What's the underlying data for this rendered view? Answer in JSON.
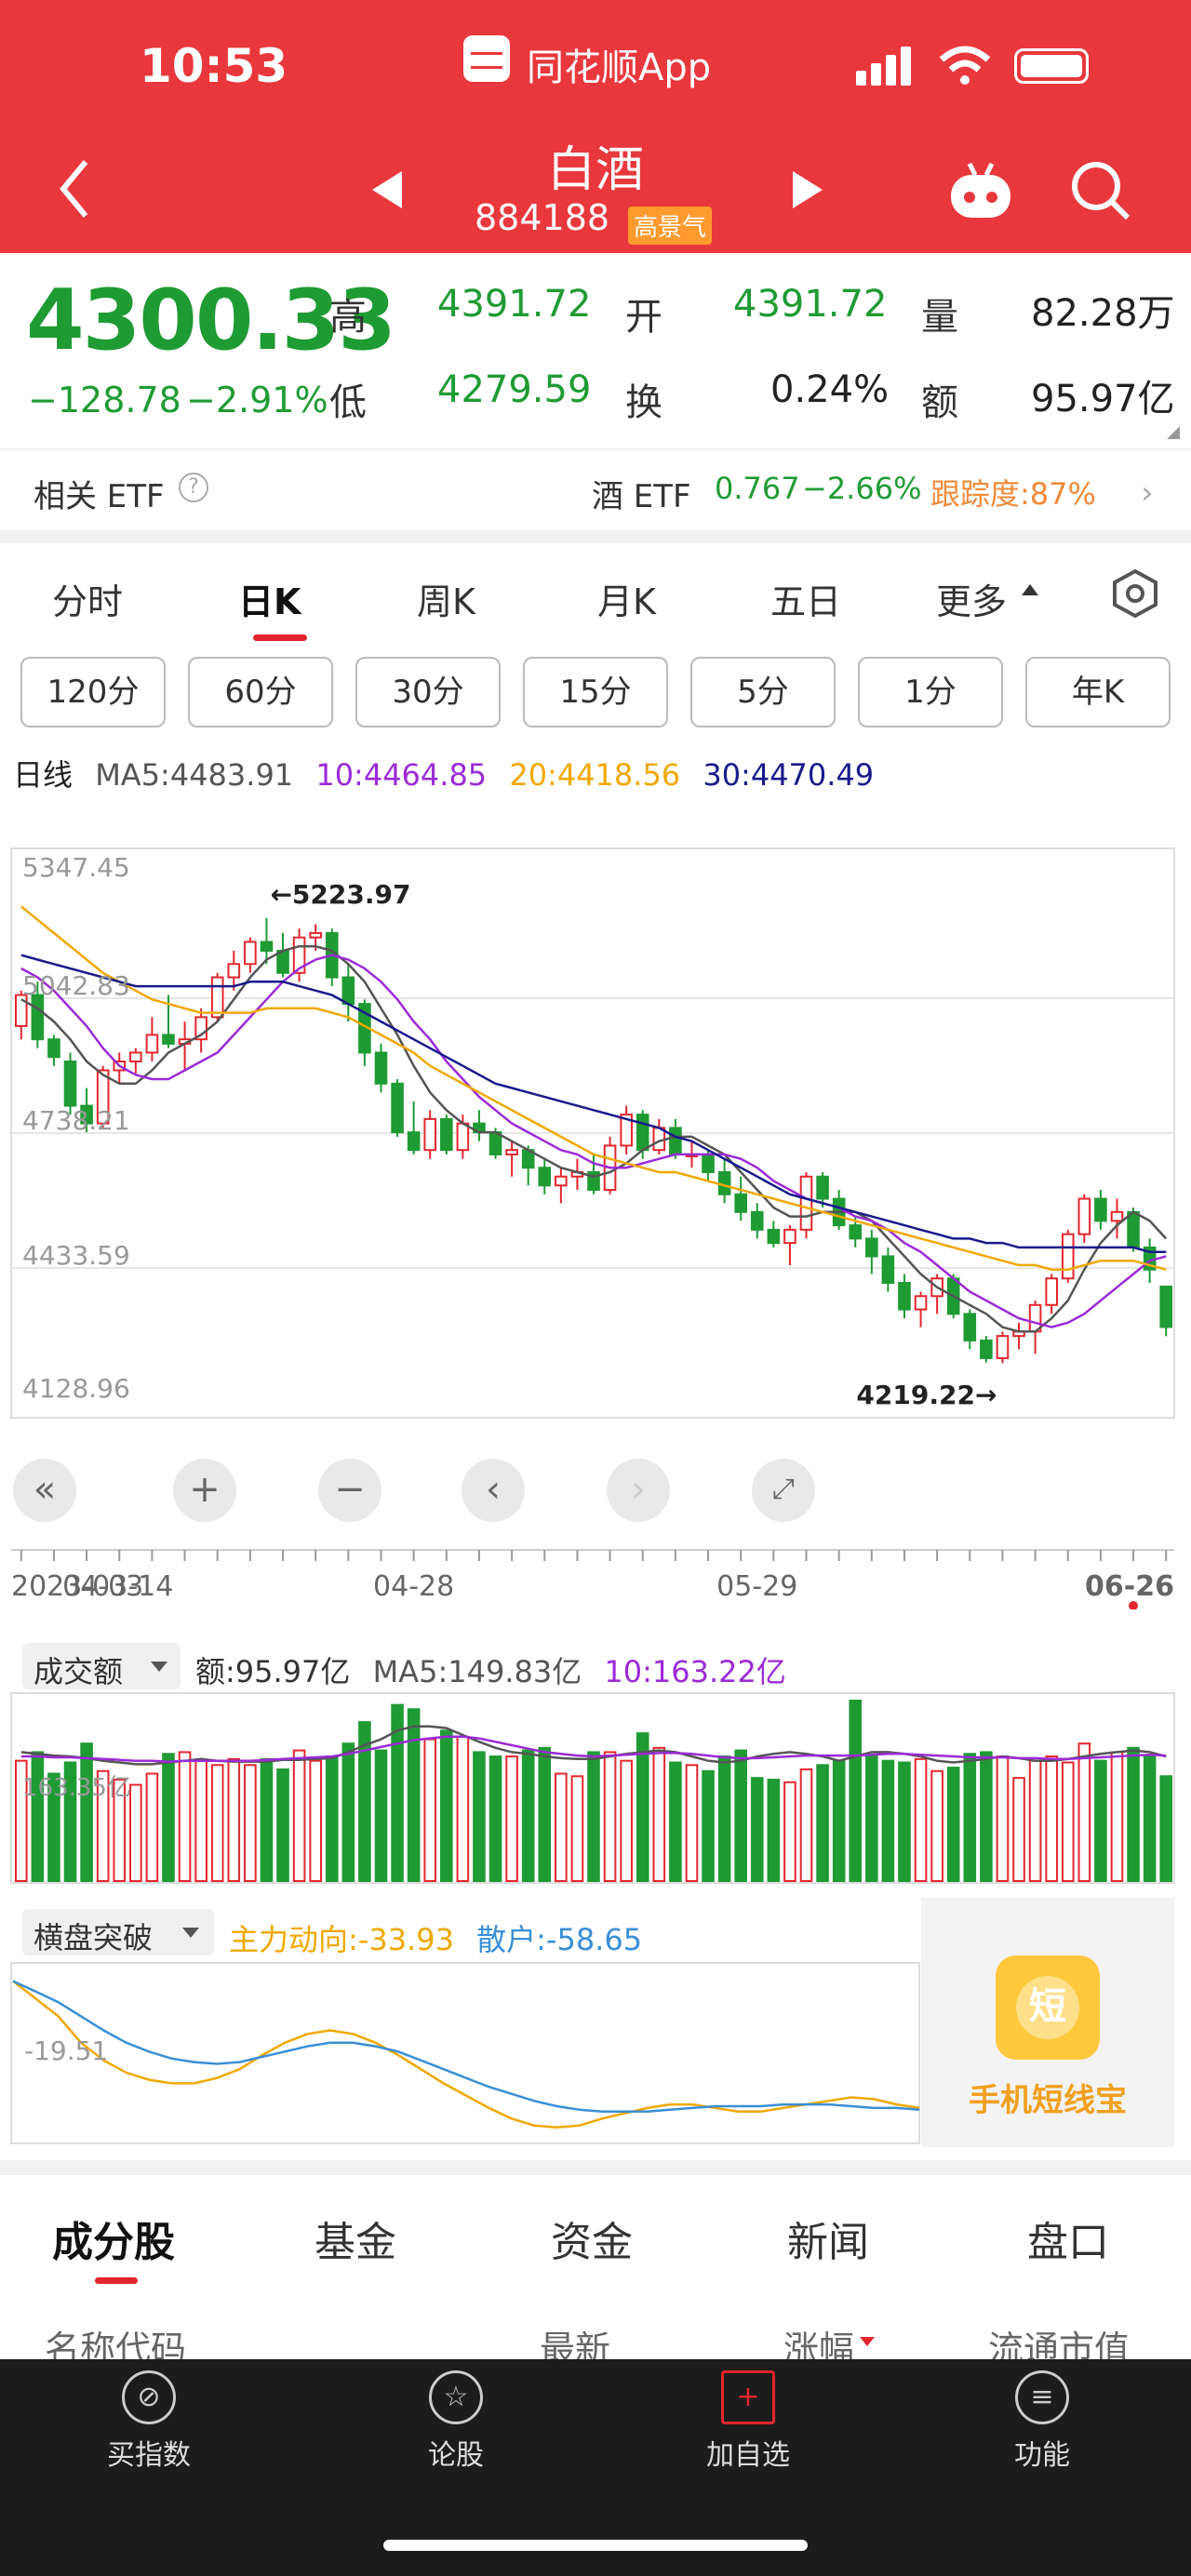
{
  "status_bar": {
    "time": "10:53",
    "app_label": "同花顺App"
  },
  "header": {
    "title": "白酒",
    "code": "884188",
    "tag": "高景气"
  },
  "quote": {
    "price": "4300.33",
    "change": "−128.78",
    "change_pct": "−2.91%",
    "high_label": "高",
    "high": "4391.72",
    "low_label": "低",
    "low": "4279.59",
    "open_label": "开",
    "open": "4391.72",
    "turnover_label": "换",
    "turnover": "0.24%",
    "volume_label": "量",
    "volume": "82.28万",
    "amount_label": "额",
    "amount": "95.97亿"
  },
  "etf": {
    "label": "相关 ETF",
    "name": "酒 ETF",
    "price": "0.767",
    "pct": "−2.66%",
    "tracking": "跟踪度:87%"
  },
  "chart_tabs": [
    "分时",
    "日K",
    "周K",
    "月K",
    "五日",
    "更多"
  ],
  "periods": [
    "120分",
    "60分",
    "30分",
    "15分",
    "5分",
    "1分",
    "年K"
  ],
  "ma_legend": {
    "prefix": "日线",
    "ma5": "MA5:4483.91",
    "ma10": "10:4464.85",
    "ma20": "20:4418.56",
    "ma30": "30:4470.49"
  },
  "colors": {
    "up": "#e3262e",
    "down": "#1f9b34",
    "ma5": "#555555",
    "ma10": "#9b2bd6",
    "ma20": "#f0a800",
    "ma30": "#1a1a8c",
    "header": "#e8383d"
  },
  "chart_data": [
    {
      "type": "candlestick",
      "y_ticks": [
        "5347.45",
        "5042.83",
        "4738.21",
        "4433.59",
        "4128.96"
      ],
      "ylim": [
        4128.96,
        5347.45
      ],
      "x_ticks": [
        "2023-03-14",
        "04-03",
        "04-28",
        "05-29",
        "06-26"
      ],
      "annotations": [
        "←5223.97",
        "4219.22→"
      ],
      "candles": [
        [
          4980,
          5060,
          4950,
          5050
        ],
        [
          5050,
          5080,
          4930,
          4950
        ],
        [
          4950,
          4960,
          4890,
          4910
        ],
        [
          4900,
          4920,
          4780,
          4800
        ],
        [
          4800,
          4840,
          4740,
          4760
        ],
        [
          4760,
          4890,
          4750,
          4880
        ],
        [
          4880,
          4920,
          4850,
          4900
        ],
        [
          4900,
          4930,
          4870,
          4920
        ],
        [
          4920,
          5000,
          4900,
          4960
        ],
        [
          4960,
          5050,
          4930,
          4940
        ],
        [
          4940,
          4990,
          4880,
          4950
        ],
        [
          4950,
          5020,
          4920,
          5000
        ],
        [
          5000,
          5100,
          4990,
          5090
        ],
        [
          5090,
          5150,
          5060,
          5120
        ],
        [
          5120,
          5180,
          5100,
          5170
        ],
        [
          5170,
          5224,
          5120,
          5150
        ],
        [
          5150,
          5190,
          5090,
          5100
        ],
        [
          5100,
          5200,
          5080,
          5180
        ],
        [
          5180,
          5210,
          5150,
          5190
        ],
        [
          5190,
          5200,
          5070,
          5090
        ],
        [
          5090,
          5120,
          4990,
          5030
        ],
        [
          5030,
          5040,
          4890,
          4920
        ],
        [
          4920,
          4940,
          4830,
          4850
        ],
        [
          4850,
          4860,
          4730,
          4740
        ],
        [
          4740,
          4810,
          4690,
          4700
        ],
        [
          4700,
          4790,
          4680,
          4770
        ],
        [
          4770,
          4780,
          4690,
          4700
        ],
        [
          4700,
          4780,
          4680,
          4760
        ],
        [
          4760,
          4790,
          4720,
          4740
        ],
        [
          4740,
          4750,
          4680,
          4690
        ],
        [
          4690,
          4720,
          4640,
          4700
        ],
        [
          4700,
          4710,
          4620,
          4660
        ],
        [
          4660,
          4680,
          4600,
          4620
        ],
        [
          4620,
          4660,
          4580,
          4640
        ],
        [
          4640,
          4680,
          4610,
          4650
        ],
        [
          4650,
          4690,
          4600,
          4610
        ],
        [
          4610,
          4730,
          4600,
          4710
        ],
        [
          4710,
          4800,
          4690,
          4780
        ],
        [
          4780,
          4790,
          4680,
          4700
        ],
        [
          4700,
          4770,
          4690,
          4750
        ],
        [
          4750,
          4770,
          4680,
          4690
        ],
        [
          4690,
          4720,
          4660,
          4690
        ],
        [
          4690,
          4700,
          4630,
          4650
        ],
        [
          4650,
          4680,
          4580,
          4600
        ],
        [
          4600,
          4640,
          4540,
          4560
        ],
        [
          4560,
          4580,
          4500,
          4520
        ],
        [
          4520,
          4540,
          4480,
          4490
        ],
        [
          4490,
          4530,
          4440,
          4520
        ],
        [
          4520,
          4650,
          4500,
          4640
        ],
        [
          4640,
          4650,
          4570,
          4590
        ],
        [
          4590,
          4610,
          4520,
          4530
        ],
        [
          4530,
          4550,
          4480,
          4500
        ],
        [
          4500,
          4520,
          4420,
          4460
        ],
        [
          4460,
          4480,
          4380,
          4400
        ],
        [
          4400,
          4420,
          4320,
          4340
        ],
        [
          4340,
          4380,
          4300,
          4370
        ],
        [
          4370,
          4420,
          4330,
          4410
        ],
        [
          4410,
          4420,
          4320,
          4330
        ],
        [
          4330,
          4340,
          4250,
          4270
        ],
        [
          4270,
          4280,
          4220,
          4230
        ],
        [
          4230,
          4290,
          4219,
          4280
        ],
        [
          4280,
          4310,
          4250,
          4290
        ],
        [
          4290,
          4360,
          4240,
          4350
        ],
        [
          4350,
          4420,
          4330,
          4410
        ],
        [
          4410,
          4520,
          4400,
          4510
        ],
        [
          4510,
          4600,
          4490,
          4590
        ],
        [
          4590,
          4610,
          4520,
          4540
        ],
        [
          4540,
          4590,
          4500,
          4560
        ],
        [
          4560,
          4570,
          4470,
          4480
        ],
        [
          4480,
          4500,
          4400,
          4430
        ],
        [
          4391.72,
          4391.72,
          4279.59,
          4300.33
        ]
      ],
      "ma_series": [
        {
          "name": "MA5",
          "values": [
            5040,
            5020,
            4990,
            4950,
            4900,
            4870,
            4850,
            4850,
            4880,
            4920,
            4940,
            4960,
            4990,
            5040,
            5090,
            5130,
            5150,
            5160,
            5160,
            5150,
            5120,
            5080,
            5020,
            4960,
            4890,
            4830,
            4790,
            4760,
            4740,
            4740,
            4720,
            4700,
            4680,
            4660,
            4650,
            4640,
            4650,
            4670,
            4700,
            4720,
            4730,
            4730,
            4710,
            4690,
            4650,
            4610,
            4570,
            4550,
            4550,
            4560,
            4560,
            4560,
            4540,
            4500,
            4460,
            4420,
            4390,
            4370,
            4350,
            4330,
            4300,
            4290,
            4290,
            4320,
            4360,
            4430,
            4490,
            4530,
            4560,
            4540,
            4500
          ]
        },
        {
          "name": "MA10",
          "values": [
            5110,
            5090,
            5060,
            5020,
            4980,
            4930,
            4890,
            4870,
            4860,
            4860,
            4880,
            4900,
            4920,
            4960,
            5000,
            5040,
            5080,
            5110,
            5130,
            5140,
            5130,
            5110,
            5080,
            5040,
            4990,
            4950,
            4900,
            4860,
            4820,
            4790,
            4760,
            4740,
            4720,
            4700,
            4690,
            4670,
            4660,
            4660,
            4670,
            4680,
            4690,
            4690,
            4690,
            4690,
            4680,
            4660,
            4630,
            4610,
            4590,
            4580,
            4570,
            4550,
            4540,
            4520,
            4490,
            4470,
            4440,
            4410,
            4380,
            4360,
            4340,
            4320,
            4310,
            4300,
            4310,
            4330,
            4360,
            4390,
            4420,
            4450,
            4460
          ]
        },
        {
          "name": "MA20",
          "values": [
            5250,
            5220,
            5190,
            5160,
            5130,
            5100,
            5080,
            5060,
            5040,
            5030,
            5020,
            5010,
            5010,
            5010,
            5010,
            5020,
            5020,
            5020,
            5020,
            5010,
            5000,
            4980,
            4960,
            4940,
            4920,
            4890,
            4870,
            4850,
            4830,
            4810,
            4790,
            4770,
            4750,
            4730,
            4710,
            4690,
            4680,
            4670,
            4660,
            4650,
            4650,
            4640,
            4630,
            4620,
            4610,
            4600,
            4590,
            4580,
            4570,
            4560,
            4550,
            4540,
            4530,
            4520,
            4510,
            4500,
            4490,
            4480,
            4470,
            4460,
            4450,
            4440,
            4440,
            4430,
            4430,
            4440,
            4450,
            4450,
            4450,
            4440,
            4430
          ]
        },
        {
          "name": "MA30",
          "values": [
            5140,
            5130,
            5120,
            5110,
            5100,
            5090,
            5080,
            5070,
            5070,
            5070,
            5070,
            5070,
            5070,
            5070,
            5080,
            5080,
            5080,
            5070,
            5060,
            5050,
            5030,
            5010,
            4990,
            4970,
            4950,
            4930,
            4910,
            4890,
            4870,
            4850,
            4840,
            4830,
            4820,
            4810,
            4800,
            4790,
            4780,
            4770,
            4760,
            4750,
            4730,
            4720,
            4700,
            4680,
            4660,
            4640,
            4620,
            4600,
            4590,
            4580,
            4570,
            4560,
            4550,
            4540,
            4530,
            4520,
            4510,
            4500,
            4500,
            4490,
            4490,
            4480,
            4480,
            4480,
            4480,
            4480,
            4480,
            4480,
            4480,
            4470,
            4470
          ]
        }
      ]
    },
    {
      "type": "bar",
      "legend": {
        "label": "成交额",
        "amount": "额:95.97亿",
        "ma5": "MA5:149.83亿",
        "ma10": "10:163.22亿"
      },
      "y_tick": "163.35亿",
      "values": [
        140,
        150,
        125,
        138,
        160,
        128,
        118,
        112,
        125,
        148,
        150,
        140,
        135,
        142,
        135,
        142,
        130,
        152,
        140,
        145,
        160,
        185,
        152,
        205,
        200,
        165,
        175,
        168,
        150,
        145,
        145,
        152,
        155,
        125,
        122,
        150,
        150,
        140,
        172,
        155,
        138,
        135,
        128,
        145,
        152,
        120,
        118,
        115,
        130,
        135,
        140,
        210,
        145,
        140,
        138,
        142,
        128,
        132,
        148,
        150,
        145,
        120,
        140,
        145,
        138,
        160,
        140,
        150,
        155,
        145,
        122
      ],
      "ma5": [
        150,
        148,
        146,
        145,
        143,
        140,
        138,
        136,
        136,
        138,
        140,
        142,
        140,
        139,
        139,
        139,
        141,
        141,
        142,
        143,
        150,
        158,
        165,
        175,
        180,
        180,
        178,
        170,
        162,
        155,
        150,
        148,
        145,
        143,
        142,
        142,
        145,
        148,
        150,
        152,
        150,
        145,
        140,
        138,
        140,
        145,
        148,
        150,
        148,
        145,
        140,
        145,
        150,
        150,
        148,
        145,
        140,
        138,
        140,
        142,
        145,
        143,
        140,
        140,
        142,
        145,
        148,
        150,
        152,
        150,
        145
      ],
      "ma10": [
        145,
        145,
        144,
        144,
        143,
        142,
        141,
        140,
        140,
        139,
        140,
        140,
        140,
        140,
        140,
        141,
        142,
        143,
        144,
        145,
        148,
        152,
        156,
        160,
        164,
        166,
        168,
        168,
        166,
        162,
        158,
        154,
        150,
        148,
        146,
        145,
        146,
        147,
        148,
        149,
        149,
        148,
        146,
        144,
        143,
        143,
        144,
        145,
        146,
        146,
        146,
        146,
        147,
        148,
        148,
        147,
        146,
        145,
        144,
        144,
        144,
        143,
        143,
        142,
        142,
        143,
        144,
        145,
        146,
        147,
        146
      ]
    },
    {
      "type": "line",
      "legend": {
        "label": "横盘突破",
        "main": "主力动向:-33.93",
        "retail": "散户:-58.65"
      },
      "y_tick": "-19.51",
      "series": [
        {
          "name": "主力动向",
          "values": [
            20,
            10,
            0,
            -15,
            -25,
            -32,
            -36,
            -38,
            -38,
            -35,
            -30,
            -22,
            -15,
            -10,
            -8,
            -10,
            -15,
            -22,
            -30,
            -38,
            -45,
            -52,
            -58,
            -62,
            -63,
            -62,
            -58,
            -55,
            -52,
            -50,
            -50,
            -52,
            -54,
            -54,
            -52,
            -50,
            -48,
            -46,
            -47,
            -50,
            -52
          ]
        },
        {
          "name": "散户",
          "values": [
            20,
            14,
            8,
            0,
            -8,
            -15,
            -20,
            -24,
            -26,
            -27,
            -26,
            -23,
            -20,
            -17,
            -15,
            -15,
            -17,
            -20,
            -25,
            -30,
            -35,
            -40,
            -44,
            -48,
            -51,
            -53,
            -54,
            -54,
            -54,
            -53,
            -52,
            -51,
            -51,
            -51,
            -50,
            -50,
            -50,
            -51,
            -52,
            -52,
            -53
          ]
        }
      ]
    }
  ],
  "promo": {
    "label": "手机短线宝",
    "icon_char": "短"
  },
  "section_tabs": [
    "成分股",
    "基金",
    "资金",
    "新闻",
    "盘口"
  ],
  "list_header": {
    "name_code": "名称代码",
    "latest": "最新",
    "change": "涨幅",
    "float_cap": "流通市值"
  },
  "bottom_nav": [
    "买指数",
    "论股",
    "加自选",
    "功能"
  ]
}
